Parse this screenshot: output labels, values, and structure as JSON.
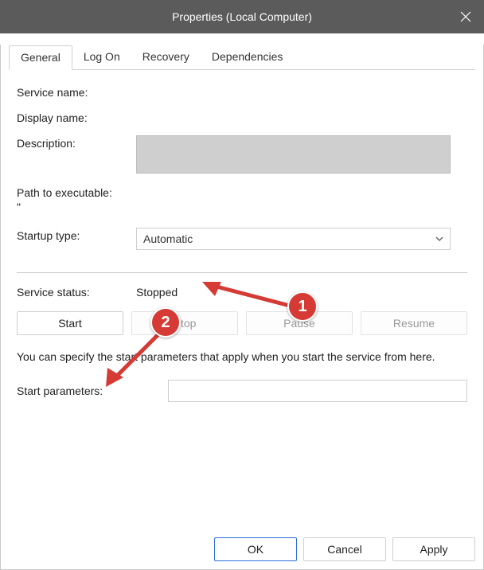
{
  "title": "Properties (Local Computer)",
  "tabs": {
    "general": "General",
    "logon": "Log On",
    "recovery": "Recovery",
    "dependencies": "Dependencies"
  },
  "labels": {
    "service_name": "Service name:",
    "display_name": "Display name:",
    "description": "Description:",
    "path": "Path to executable:",
    "startup_type": "Startup type:",
    "service_status": "Service status:",
    "start_params": "Start parameters:"
  },
  "values": {
    "service_name": "",
    "display_name": "",
    "description": "",
    "path": "\"",
    "startup_selected": "Automatic",
    "status": "Stopped",
    "start_params": ""
  },
  "buttons": {
    "start": "Start",
    "stop": "Stop",
    "pause": "Pause",
    "resume": "Resume",
    "ok": "OK",
    "cancel": "Cancel",
    "apply": "Apply"
  },
  "note": "You can specify the start parameters that apply when you start the service from here.",
  "annotations": {
    "a1": "1",
    "a2": "2"
  }
}
